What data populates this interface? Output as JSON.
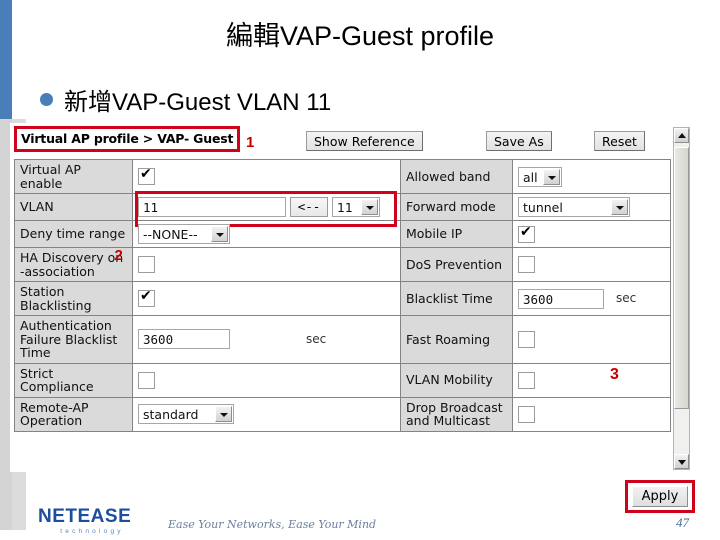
{
  "slide": {
    "title": "編輯VAP-Guest profile",
    "bullet_text": "新增VAP-Guest  VLAN 11",
    "page_number": "47"
  },
  "webui": {
    "breadcrumb": "Virtual AP profile > VAP- Guest",
    "toolbar_buttons": {
      "show_reference": "Show Reference",
      "save_as": "Save As",
      "reset": "Reset"
    },
    "rows": [
      {
        "left_label": "Virtual AP enable",
        "left_control": "checkbox",
        "left_value": "checked",
        "right_label": "Allowed band",
        "right_control": "select",
        "right_value": "all"
      },
      {
        "left_label": "VLAN",
        "left_control": "vlan-group",
        "left_value": "11",
        "left_button": "<--",
        "left_select_value": "11",
        "right_label": "Forward mode",
        "right_control": "select",
        "right_value": "tunnel"
      },
      {
        "left_label": "Deny time range",
        "left_control": "select",
        "left_value": "--NONE--",
        "right_label": "Mobile IP",
        "right_control": "checkbox",
        "right_value": "checked"
      },
      {
        "left_label": "HA Discovery on -association",
        "left_control": "checkbox",
        "left_value": "unchecked",
        "right_label": "DoS Prevention",
        "right_control": "checkbox",
        "right_value": "unchecked"
      },
      {
        "left_label": "Station Blacklisting",
        "left_control": "checkbox",
        "left_value": "checked",
        "right_label": "Blacklist Time",
        "right_control": "text-unit",
        "right_value": "3600",
        "right_unit": "sec"
      },
      {
        "left_label": "Authentication Failure Blacklist Time",
        "left_control": "text-unit",
        "left_value": "3600",
        "left_unit": "sec",
        "right_label": "Fast Roaming",
        "right_control": "checkbox",
        "right_value": "unchecked"
      },
      {
        "left_label": "Strict Compliance",
        "left_control": "checkbox",
        "left_value": "unchecked",
        "right_label": "VLAN Mobility",
        "right_control": "checkbox",
        "right_value": "unchecked"
      },
      {
        "left_label": "Remote-AP Operation",
        "left_control": "select",
        "left_value": "standard",
        "right_label": "Drop Broadcast and Multicast",
        "right_control": "checkbox",
        "right_value": "unchecked"
      }
    ],
    "apply_label": "Apply"
  },
  "annotations": {
    "marker_1": "1",
    "marker_2": "2",
    "marker_3": "3",
    "highlight_color": "#d0021b"
  },
  "footer": {
    "logo_main": "NETEASE",
    "logo_sub": "technology",
    "tagline": "Ease Your Networks, Ease Your Mind"
  },
  "colors": {
    "accent_blue": "#4a7ebb",
    "logo_blue": "#1d4e9c",
    "annotation_red": "#d0021b"
  }
}
